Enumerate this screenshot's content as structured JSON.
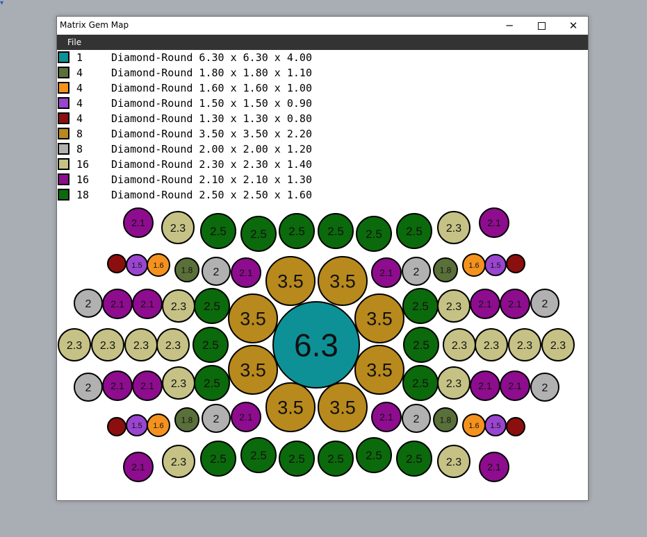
{
  "window": {
    "title": "Matrix Gem Map"
  },
  "menu": {
    "file_label": "File"
  },
  "window_controls": {
    "minimize_glyph": "─",
    "close_glyph": "✕"
  },
  "legend": [
    {
      "count": "1",
      "description": "Diamond-Round 6.30 x 6.30 x 4.00",
      "color": "#0e9196"
    },
    {
      "count": "4",
      "description": "Diamond-Round 1.80 x 1.80 x 1.10",
      "color": "#5a703a"
    },
    {
      "count": "4",
      "description": "Diamond-Round 1.60 x 1.60 x 1.00",
      "color": "#f4921e"
    },
    {
      "count": "4",
      "description": "Diamond-Round 1.50 x 1.50 x 0.90",
      "color": "#9a45cf"
    },
    {
      "count": "4",
      "description": "Diamond-Round 1.30 x 1.30 x 0.80",
      "color": "#8b0f0f"
    },
    {
      "count": "8",
      "description": "Diamond-Round 3.50 x 3.50 x 2.20",
      "color": "#b8891c"
    },
    {
      "count": "8",
      "description": "Diamond-Round 2.00 x 2.00 x 1.20",
      "color": "#b1b1b1"
    },
    {
      "count": "16",
      "description": "Diamond-Round 2.30 x 2.30 x 1.40",
      "color": "#c6c286"
    },
    {
      "count": "16",
      "description": "Diamond-Round 2.10 x 2.10 x 1.30",
      "color": "#8e0c8e"
    },
    {
      "count": "18",
      "description": "Diamond-Round 2.50 x 2.50 x 1.60",
      "color": "#0b6a0b"
    }
  ],
  "gem_colors": {
    "6.3": "#0e9196",
    "3.5": "#b8891c",
    "2.5": "#0b6a0b",
    "2.3": "#c6c286",
    "2.1": "#8e0c8e",
    "2": "#b1b1b1",
    "1.8": "#5a703a",
    "1.6": "#f4921e",
    "1.5": "#9a45cf",
    "1.3": "#8b0f0f"
  },
  "gem_labels": {
    "6.3": "6.3",
    "3.5": "3.5",
    "2.5": "2.5",
    "2.3": "2.3",
    "2.1": "2.1",
    "2": "2",
    "1.8": "1.8",
    "1.6": "1.6",
    "1.5": "1.5",
    "1.3": ""
  },
  "gem_counts": {
    "6.3": 1,
    "3.5": 8,
    "2.5": 18,
    "2.3": 16,
    "2.1": 16,
    "2": 8,
    "1.8": 4,
    "1.6": 4,
    "1.5": 4,
    "1.3": 4
  }
}
